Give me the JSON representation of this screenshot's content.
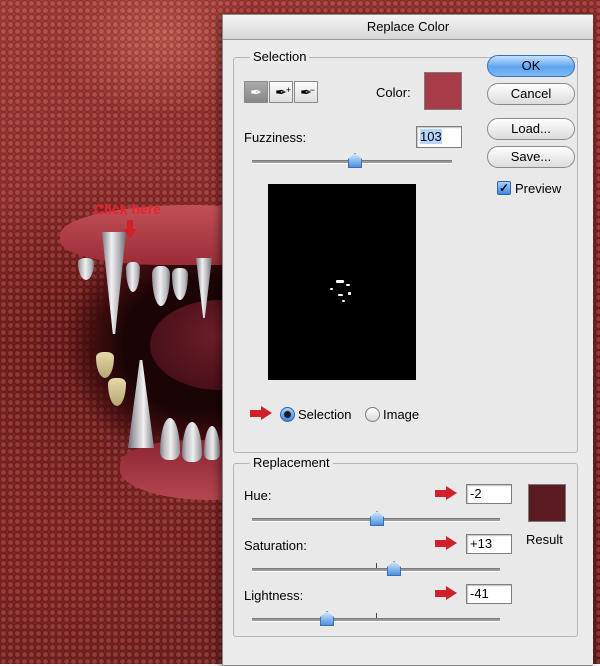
{
  "photo": {
    "annotation_text": "Click here"
  },
  "dialog": {
    "title": "Replace Color",
    "buttons": {
      "ok": "OK",
      "cancel": "Cancel",
      "load": "Load...",
      "save": "Save..."
    },
    "preview_checkbox": {
      "label": "Preview",
      "checked": true
    },
    "selection": {
      "group_title": "Selection",
      "color_label": "Color:",
      "color_swatch": "#a83b48",
      "tools": [
        "eyedropper-icon",
        "eyedropper-plus-icon",
        "eyedropper-minus-icon"
      ],
      "fuzziness_label": "Fuzziness:",
      "fuzziness_value": "103",
      "fuzziness_fraction": 0.51,
      "view_options": [
        {
          "label": "Selection",
          "selected": true
        },
        {
          "label": "Image",
          "selected": false
        }
      ]
    },
    "replacement": {
      "group_title": "Replacement",
      "hue": {
        "label": "Hue:",
        "value": "-2"
      },
      "saturation": {
        "label": "Saturation:",
        "value": "+13"
      },
      "lightness": {
        "label": "Lightness:",
        "value": "-41"
      },
      "result_label": "Result",
      "result_swatch": "#5a1b22"
    }
  },
  "colors": {
    "arrow_red": "#d0202a",
    "accent_blue": "#3d88e6"
  }
}
